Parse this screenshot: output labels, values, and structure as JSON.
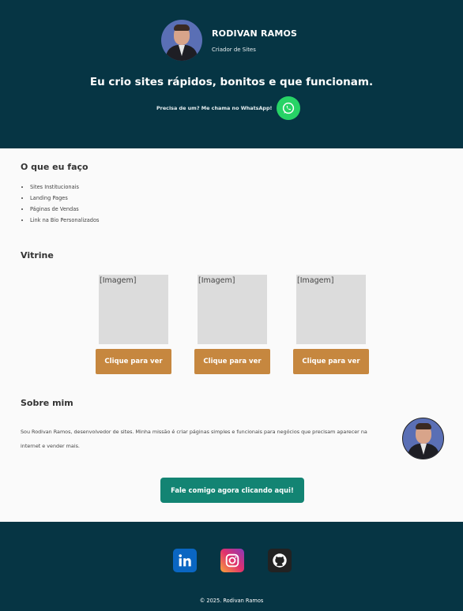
{
  "header": {
    "name": "RODIVAN RAMOS",
    "role": "Criador de Sites",
    "tagline": "Eu crio sites rápidos, bonitos e que funcionam.",
    "whatsapp_text": "Precisa de um? Me chama no WhatsApp!"
  },
  "services": {
    "title": "O que eu faço",
    "items": [
      "Sites Institucionais",
      "Landing Pages",
      "Páginas de Vendas",
      "Link na Bio Personalizados"
    ]
  },
  "gallery": {
    "title": "Vitrine",
    "items": [
      {
        "image_label": "[Imagem]",
        "button": "Clique para ver"
      },
      {
        "image_label": "[Imagem]",
        "button": "Clique para ver"
      },
      {
        "image_label": "[Imagem]",
        "button": "Clique para ver"
      }
    ]
  },
  "about": {
    "title": "Sobre mim",
    "text": "Sou Rodivan Ramos, desenvolvedor de sites. Minha missão é criar páginas simples e funcionais para negócios que precisam aparecer na internet e vender mais."
  },
  "cta": {
    "label": "Fale comigo agora clicando aqui!"
  },
  "footer": {
    "social": [
      {
        "icon": "linkedin-icon",
        "color": "#0a66c2"
      },
      {
        "icon": "instagram-icon",
        "color": "#e1306c"
      },
      {
        "icon": "github-icon",
        "color": "#222222"
      }
    ],
    "copyright": "© 2025. Rodivan Ramos"
  },
  "colors": {
    "header_bg": "#063544",
    "accent_orange": "#c6873f",
    "cta_green": "#138473",
    "whatsapp_green": "#27d366"
  }
}
